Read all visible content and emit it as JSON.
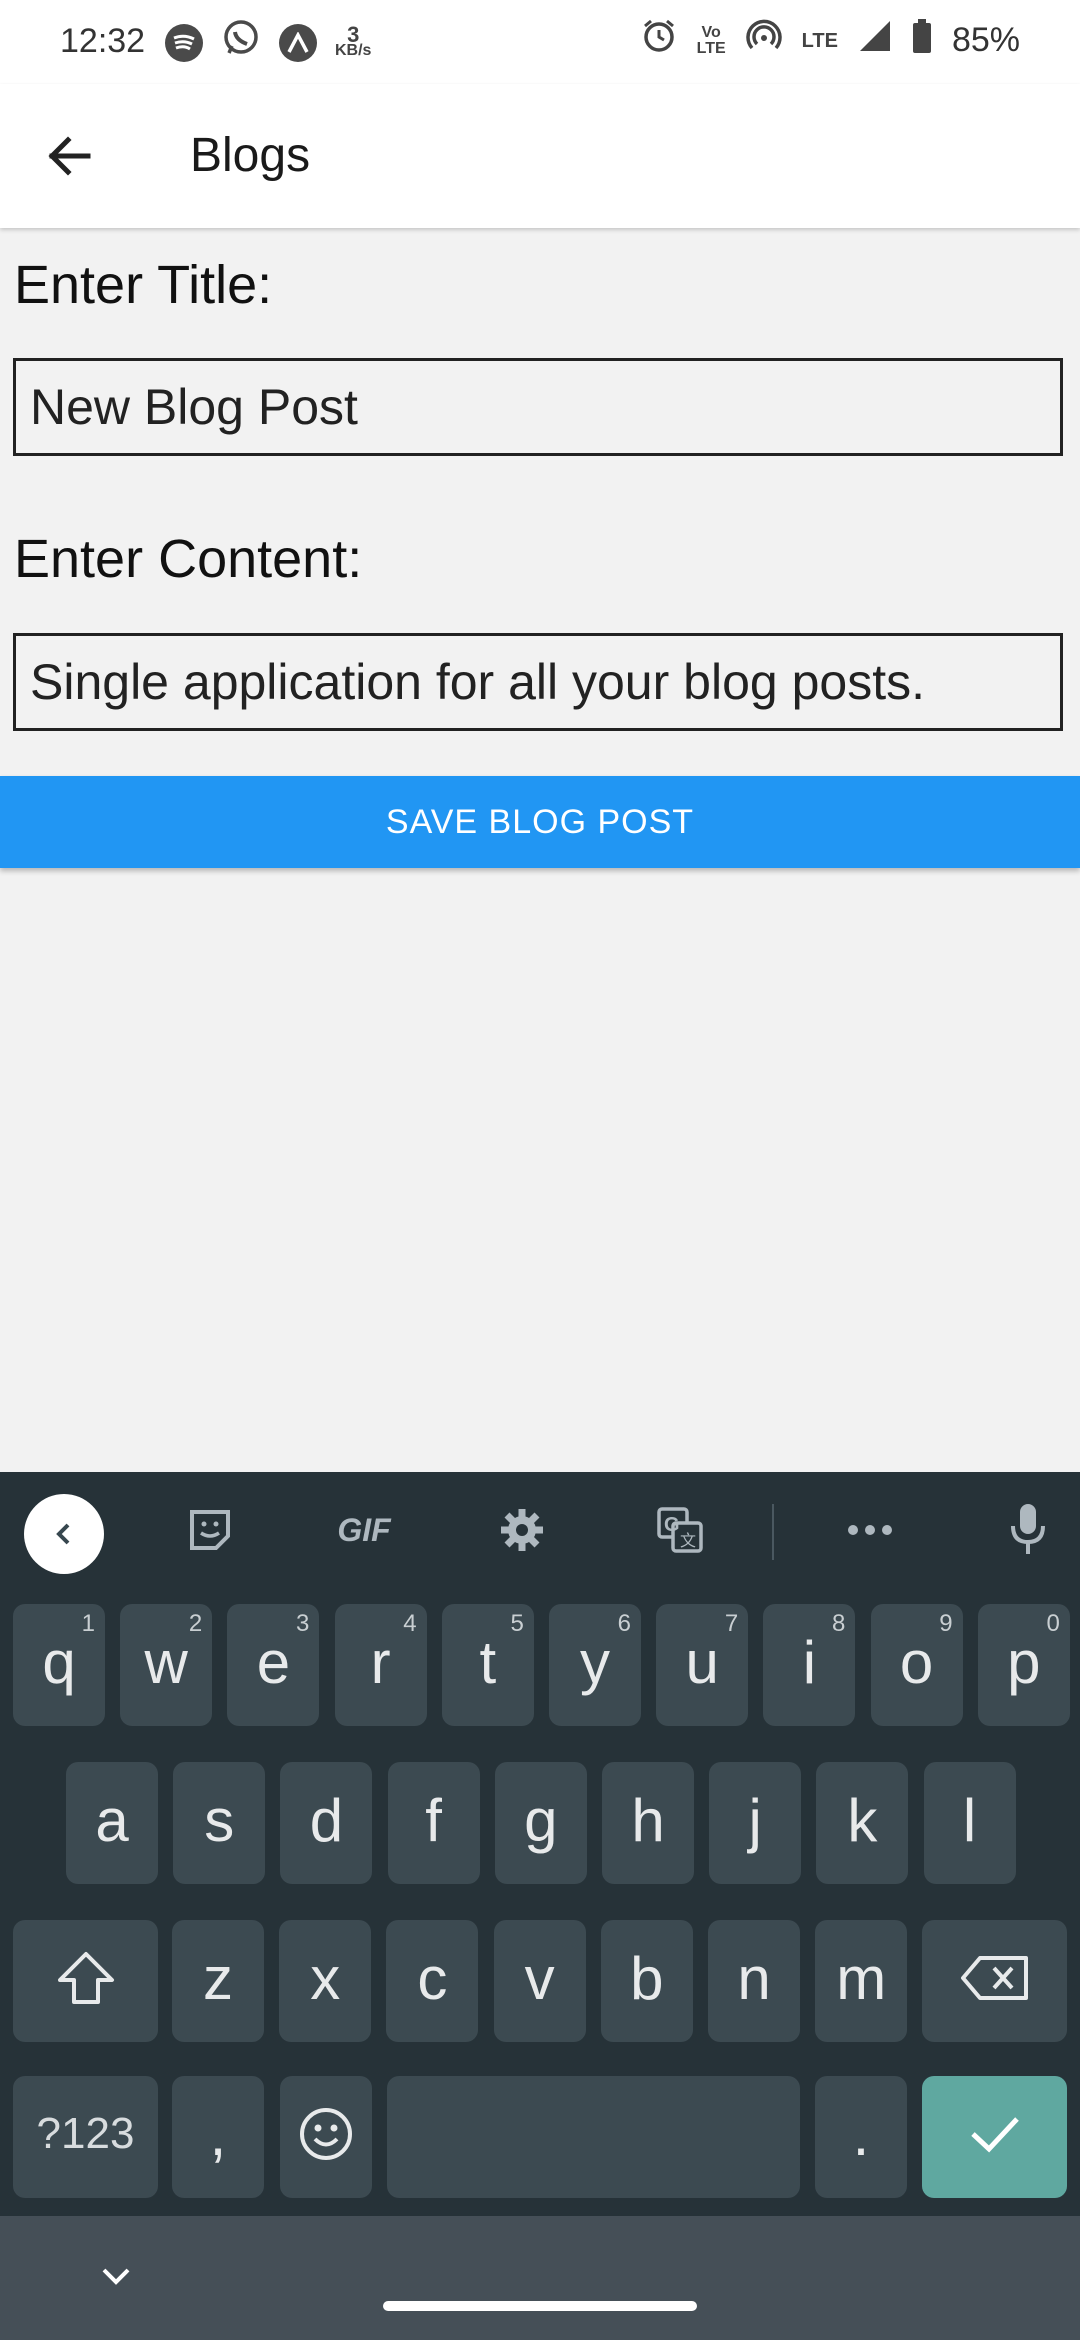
{
  "status_bar": {
    "time": "12:32",
    "speed_value": "3",
    "speed_unit": "KB/s",
    "volte_top": "Vo",
    "volte_bottom": "LTE",
    "lte_label": "LTE",
    "battery_percent": "85%"
  },
  "app_bar": {
    "title": "Blogs"
  },
  "form": {
    "title_label": "Enter Title:",
    "title_value": "New Blog Post",
    "content_label": "Enter Content:",
    "content_value": "Single application for all your blog posts.",
    "save_label": "SAVE BLOG POST"
  },
  "keyboard": {
    "toolbar": {
      "gif_label": "GIF"
    },
    "row1": [
      {
        "key": "q",
        "hint": "1"
      },
      {
        "key": "w",
        "hint": "2"
      },
      {
        "key": "e",
        "hint": "3"
      },
      {
        "key": "r",
        "hint": "4"
      },
      {
        "key": "t",
        "hint": "5"
      },
      {
        "key": "y",
        "hint": "6"
      },
      {
        "key": "u",
        "hint": "7"
      },
      {
        "key": "i",
        "hint": "8"
      },
      {
        "key": "o",
        "hint": "9"
      },
      {
        "key": "p",
        "hint": "0"
      }
    ],
    "row2": [
      "a",
      "s",
      "d",
      "f",
      "g",
      "h",
      "j",
      "k",
      "l"
    ],
    "row3": [
      "z",
      "x",
      "c",
      "v",
      "b",
      "n",
      "m"
    ],
    "symbols_label": "?123",
    "comma_label": ",",
    "period_label": "."
  },
  "colors": {
    "accent": "#2196f3",
    "keyboard_bg": "#263238",
    "key_bg": "#3c4a51",
    "enter_key": "#5fa8a0"
  }
}
